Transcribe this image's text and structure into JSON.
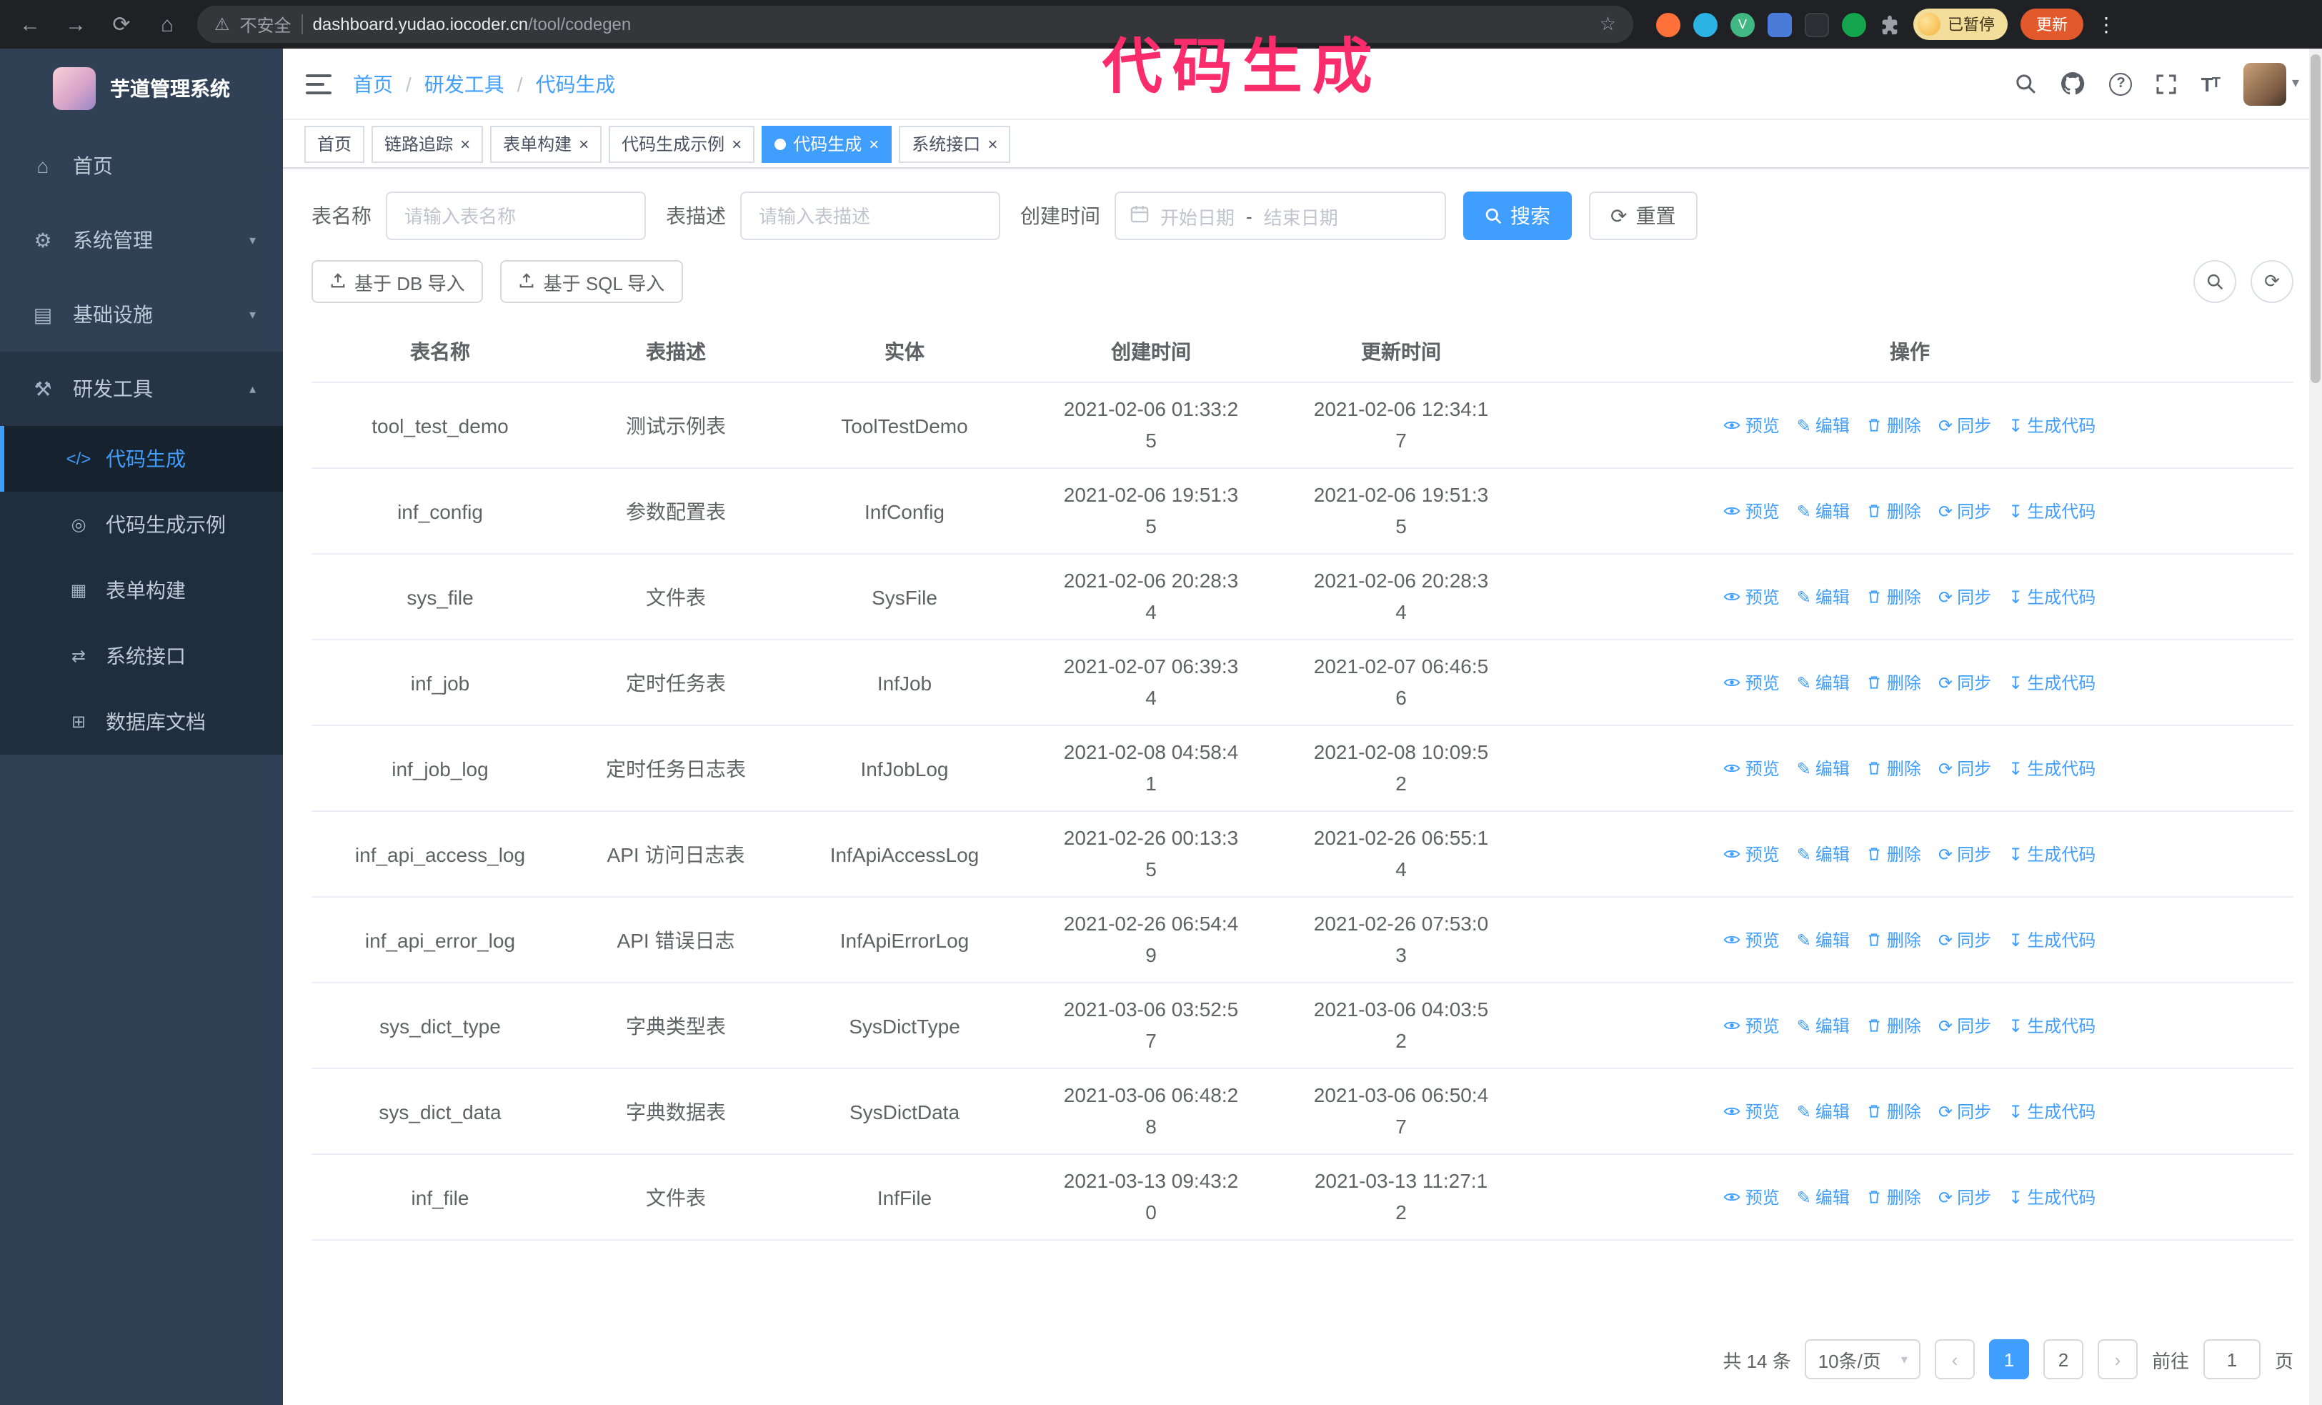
{
  "colors": {
    "primary": "#409eff",
    "annotation_pink": "#fa2c6b",
    "sidebar_bg": "#304156",
    "submenu_bg": "#1f2d3d"
  },
  "annotation": {
    "text": "代码生成"
  },
  "browser": {
    "insecure_label": "不安全",
    "url_domain": "dashboard.yudao.iocoder.cn",
    "url_path": "/tool/codegen",
    "vue_badge": "V",
    "profile_badge": "已暂停",
    "update_label": "更新"
  },
  "icons": {
    "back": "←",
    "forward": "→",
    "reload": "⟳",
    "home_nav": "⌂",
    "warning": "⚠",
    "star": "☆",
    "dots": "⋮",
    "home": "⌂",
    "gear": "⚙",
    "infra": "▤",
    "tools": "⚒",
    "code": "</>",
    "example": "◎",
    "form": "▦",
    "api": "⇄",
    "dbdoc": "⊞",
    "chevron_down": "▾",
    "chevron_up": "▴",
    "caret": "▾",
    "edit": "✎",
    "sync": "⟳",
    "download": "↧",
    "refresh": "⟳",
    "close": "×",
    "prev": "‹",
    "next": "›",
    "question": "?",
    "range_dash": "-"
  },
  "sidebar": {
    "title": "芋道管理系统",
    "items": [
      {
        "label": "首页"
      },
      {
        "label": "系统管理"
      },
      {
        "label": "基础设施"
      },
      {
        "label": "研发工具"
      }
    ],
    "subitems": [
      {
        "label": "代码生成"
      },
      {
        "label": "代码生成示例"
      },
      {
        "label": "表单构建"
      },
      {
        "label": "系统接口"
      },
      {
        "label": "数据库文档"
      }
    ]
  },
  "breadcrumb": {
    "items": [
      "首页",
      "研发工具",
      "代码生成"
    ],
    "separator": "/"
  },
  "tabs": [
    {
      "label": "首页"
    },
    {
      "label": "链路追踪"
    },
    {
      "label": "表单构建"
    },
    {
      "label": "代码生成示例"
    },
    {
      "label": "代码生成"
    },
    {
      "label": "系统接口"
    }
  ],
  "filters": {
    "table_name_label": "表名称",
    "table_name_placeholder": "请输入表名称",
    "table_desc_label": "表描述",
    "table_desc_placeholder": "请输入表描述",
    "create_time_label": "创建时间",
    "start_placeholder": "开始日期",
    "end_placeholder": "结束日期",
    "search_button": "搜索",
    "reset_button": "重置"
  },
  "toolbar": {
    "import_db_button": "基于 DB 导入",
    "import_sql_button": "基于 SQL 导入"
  },
  "table": {
    "columns": [
      "表名称",
      "表描述",
      "实体",
      "创建时间",
      "更新时间",
      "操作"
    ],
    "actions": [
      "预览",
      "编辑",
      "删除",
      "同步",
      "生成代码"
    ],
    "rows": [
      {
        "name": "tool_test_demo",
        "desc": "测试示例表",
        "entity": "ToolTestDemo",
        "created": "2021-02-06 01:33:25",
        "updated": "2021-02-06 12:34:17"
      },
      {
        "name": "inf_config",
        "desc": "参数配置表",
        "entity": "InfConfig",
        "created": "2021-02-06 19:51:35",
        "updated": "2021-02-06 19:51:35"
      },
      {
        "name": "sys_file",
        "desc": "文件表",
        "entity": "SysFile",
        "created": "2021-02-06 20:28:34",
        "updated": "2021-02-06 20:28:34"
      },
      {
        "name": "inf_job",
        "desc": "定时任务表",
        "entity": "InfJob",
        "created": "2021-02-07 06:39:34",
        "updated": "2021-02-07 06:46:56"
      },
      {
        "name": "inf_job_log",
        "desc": "定时任务日志表",
        "entity": "InfJobLog",
        "created": "2021-02-08 04:58:41",
        "updated": "2021-02-08 10:09:52"
      },
      {
        "name": "inf_api_access_log",
        "desc": "API 访问日志表",
        "entity": "InfApiAccessLog",
        "created": "2021-02-26 00:13:35",
        "updated": "2021-02-26 06:55:14"
      },
      {
        "name": "inf_api_error_log",
        "desc": "API 错误日志",
        "entity": "InfApiErrorLog",
        "created": "2021-02-26 06:54:49",
        "updated": "2021-02-26 07:53:03"
      },
      {
        "name": "sys_dict_type",
        "desc": "字典类型表",
        "entity": "SysDictType",
        "created": "2021-03-06 03:52:57",
        "updated": "2021-03-06 04:03:52"
      },
      {
        "name": "sys_dict_data",
        "desc": "字典数据表",
        "entity": "SysDictData",
        "created": "2021-03-06 06:48:28",
        "updated": "2021-03-06 06:50:47"
      },
      {
        "name": "inf_file",
        "desc": "文件表",
        "entity": "InfFile",
        "created": "2021-03-13 09:43:20",
        "updated": "2021-03-13 11:27:12"
      }
    ]
  },
  "pagination": {
    "total": "共 14 条",
    "page_size": "10条/页",
    "pages": [
      "1",
      "2"
    ],
    "active_page": "1",
    "goto_label": "前往",
    "goto_value": "1",
    "goto_suffix": "页"
  }
}
